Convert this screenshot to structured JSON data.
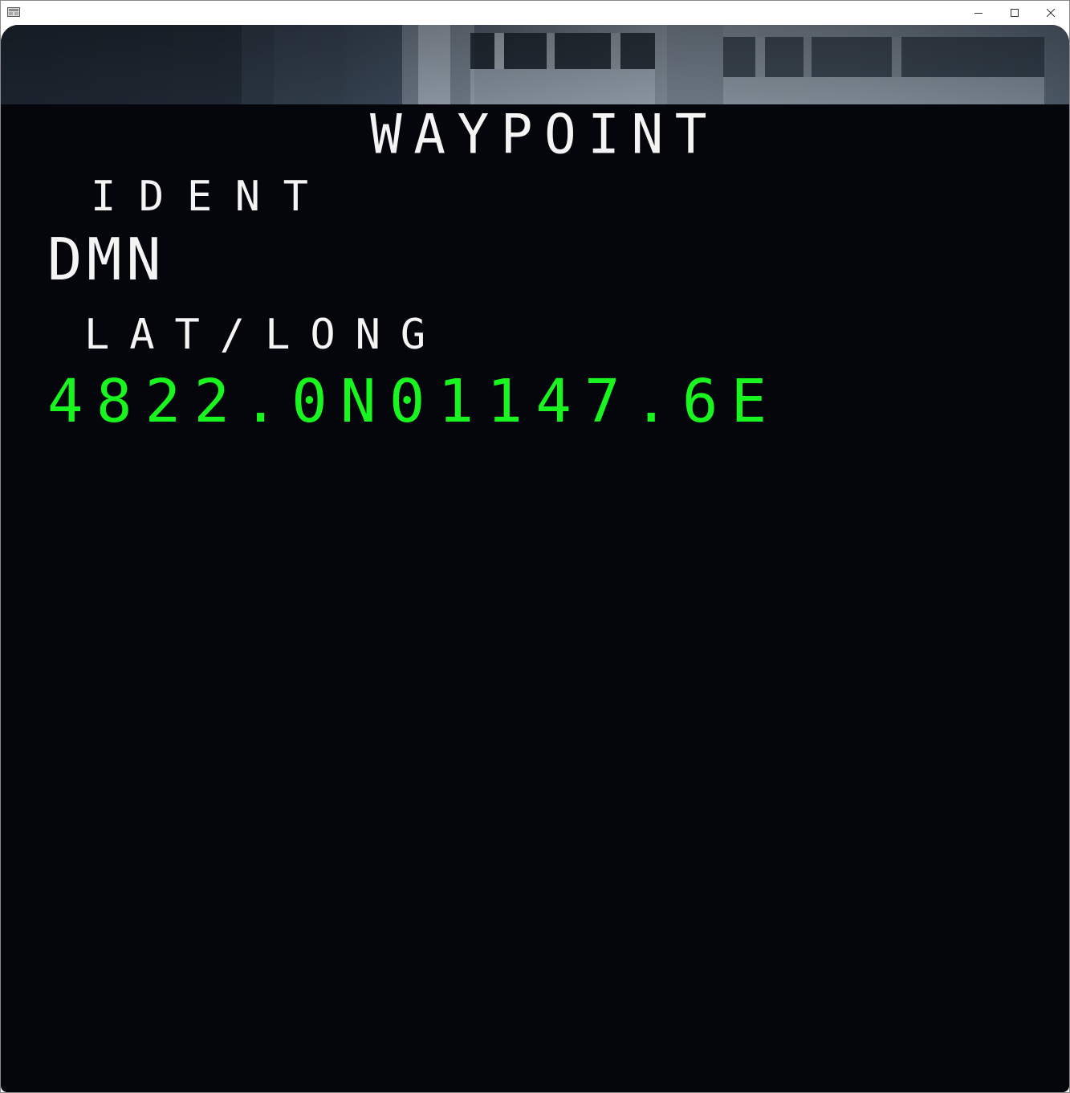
{
  "window": {
    "controls": {
      "minimize_icon": "minimize-icon",
      "maximize_icon": "maximize-icon",
      "close_icon": "close-icon"
    }
  },
  "cdu": {
    "page_title": "WAYPOINT",
    "ident_label": "IDENT",
    "ident_value": "DMN",
    "latlong_label": "LAT/LONG",
    "latlong_value": "4822.0N01147.6E"
  },
  "colors": {
    "screen_background": "#05050c",
    "label_text": "#f4f4f4",
    "data_green": "#19f51e"
  }
}
